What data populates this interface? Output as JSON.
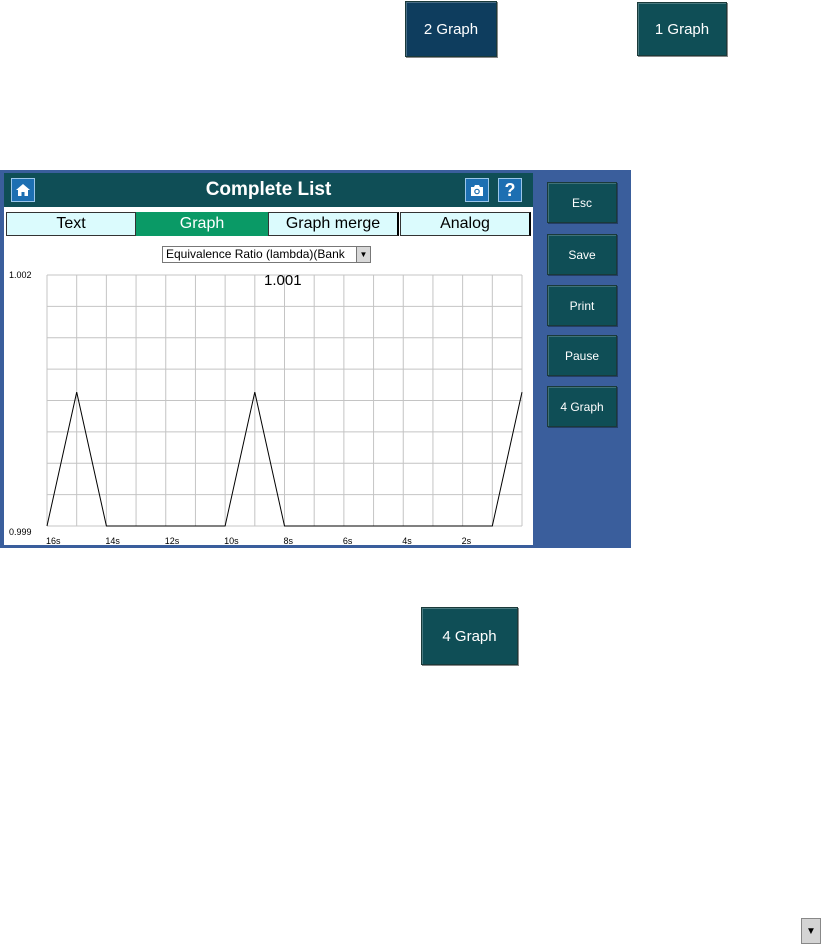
{
  "top_buttons": {
    "two_graph": "2 Graph",
    "one_graph": "1 Graph"
  },
  "bottom_button": {
    "four_graph": "4 Graph"
  },
  "app": {
    "title": "Complete List",
    "tabs": [
      {
        "label": "Text",
        "active": false
      },
      {
        "label": "Graph",
        "active": true
      },
      {
        "label": "Graph merge",
        "active": false
      },
      {
        "label": "Analog",
        "active": false
      }
    ],
    "parameter_select": {
      "value": "Equivalence Ratio (lambda)(Bank"
    },
    "side_buttons": [
      {
        "label": "Esc"
      },
      {
        "label": "Save"
      },
      {
        "label": "Print"
      },
      {
        "label": "Pause"
      },
      {
        "label": "4 Graph"
      }
    ]
  },
  "colors": {
    "header": "#0f4e56",
    "side_panel": "#3a5e9c",
    "active_tab": "#0a9a66",
    "inactive_tab": "#dbfbfd"
  },
  "icons": {
    "home": "home-icon",
    "camera": "camera-icon",
    "help": "help-icon",
    "dropdown": "chevron-down-icon"
  },
  "chart_data": {
    "type": "line",
    "current_value": "1.001",
    "y_max_label": "1.002",
    "y_min_label": "0.999",
    "ylim": [
      0.999,
      1.002
    ],
    "x_tick_labels": [
      "16s",
      "14s",
      "12s",
      "10s",
      "8s",
      "6s",
      "4s",
      "2s"
    ],
    "xlim": [
      -16,
      0
    ],
    "grid": true,
    "series": [
      {
        "x": [
          -16,
          -15,
          -14,
          -12,
          -10,
          -9,
          -8,
          -6,
          -4,
          -2,
          -1,
          0
        ],
        "y": [
          0.999,
          1.0006,
          0.999,
          0.999,
          0.999,
          1.0006,
          0.999,
          0.999,
          0.999,
          0.999,
          0.999,
          1.0006
        ]
      }
    ]
  }
}
